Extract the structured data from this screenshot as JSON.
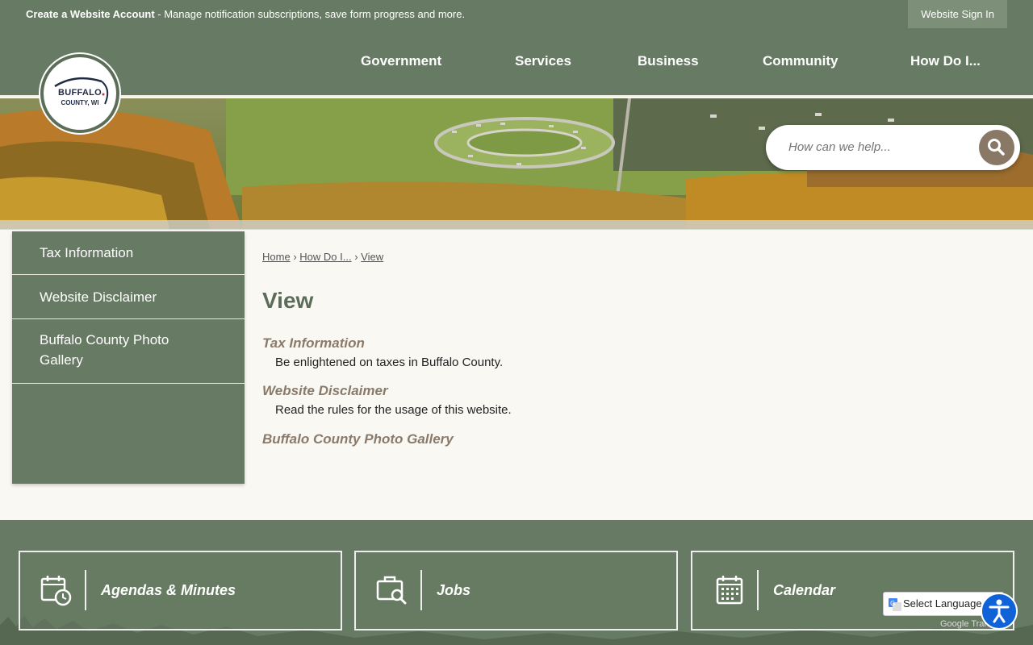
{
  "topbar": {
    "account_link": "Create a Website Account",
    "account_desc": " - Manage notification subscriptions, save form progress and more.",
    "signin_label": "Website Sign In"
  },
  "nav": {
    "items": [
      "Government",
      "Services",
      "Business",
      "Community",
      "How Do I..."
    ]
  },
  "logo": {
    "line1": "BUFFALO",
    "line2": "COUNTY, WI"
  },
  "search": {
    "placeholder": "How can we help...",
    "icon": "search-icon"
  },
  "sidebar": {
    "items": [
      {
        "label": "Tax Information"
      },
      {
        "label": "Website Disclaimer"
      },
      {
        "label": "Buffalo County Photo Gallery"
      }
    ]
  },
  "breadcrumb": {
    "home": "Home",
    "sep1": "›",
    "how": "How Do I...",
    "sep2": "›",
    "current": "View"
  },
  "page": {
    "title": "View",
    "items": [
      {
        "title": "Tax Information",
        "desc": "Be enlightened on taxes in Buffalo County."
      },
      {
        "title": "Website Disclaimer",
        "desc": "Read the rules for the usage of this website."
      },
      {
        "title": "Buffalo County Photo Gallery",
        "desc": ""
      }
    ]
  },
  "tiles": [
    {
      "label": "Agendas & Minutes",
      "icon": "calendar-clock-icon"
    },
    {
      "label": "Jobs",
      "icon": "briefcase-search-icon"
    },
    {
      "label": "Calendar",
      "icon": "calendar-icon"
    }
  ],
  "translate": {
    "label": "Select Language",
    "powered": "Google Translate"
  },
  "colors": {
    "primary_green": "#677a63",
    "accent_brown": "#8a7866",
    "title_green": "#5c6c58",
    "background": "#faf8f3"
  }
}
